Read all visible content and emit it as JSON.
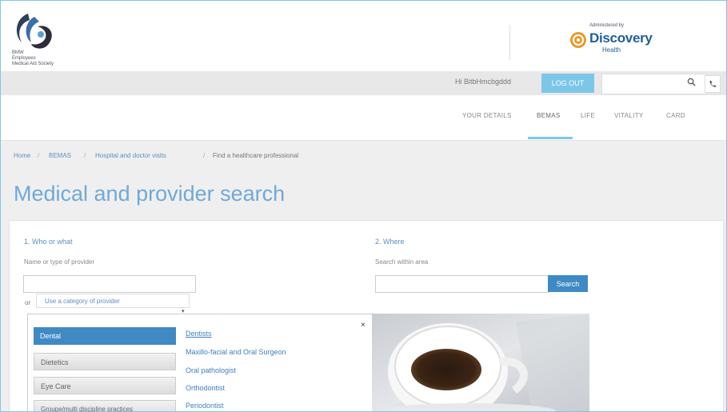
{
  "header": {
    "logo_text": [
      "BMW",
      "Employees",
      "Medical Aid Society"
    ],
    "admin_label": "Administered by",
    "brand_name": "Discovery",
    "brand_sub": "Health"
  },
  "topbar": {
    "greeting": "Hi BitbHmcbgddd",
    "logout_label": "LOG OUT",
    "search_value": "",
    "icons": [
      "search-icon",
      "phone-icon"
    ]
  },
  "nav": {
    "items": [
      "YOUR DETAILS",
      "BEMAS",
      "LIFE",
      "VITALITY",
      "CARD"
    ],
    "active": "BEMAS"
  },
  "breadcrumb": {
    "items": [
      "Home",
      "BEMAS",
      "Hospital and doctor visits",
      "Find a healthcare professional"
    ]
  },
  "page": {
    "title": "Medical and provider search"
  },
  "who": {
    "heading": "1. Who or what",
    "label": "Name or type of provider",
    "value": "",
    "or_label": "or",
    "category_placeholder": "Use a category of provider"
  },
  "where": {
    "heading": "2. Where",
    "label": "Search within area",
    "value": "",
    "search_label": "Search"
  },
  "dropdown": {
    "categories": [
      "Dental",
      "Dietetics",
      "Eye Care",
      "Groupe/multi discipline practices"
    ],
    "active_category": "Dental",
    "subcategories": [
      "Dentists",
      "Maxillo-facial and Oral Surgeon",
      "Oral pathologist",
      "Orthodontist",
      "Periodontist"
    ],
    "close_symbol": "×"
  },
  "colors": {
    "accent": "#7cc7e8",
    "primary": "#3f8ac4",
    "title": "#6fa9d8",
    "link": "#5b8fc4"
  }
}
